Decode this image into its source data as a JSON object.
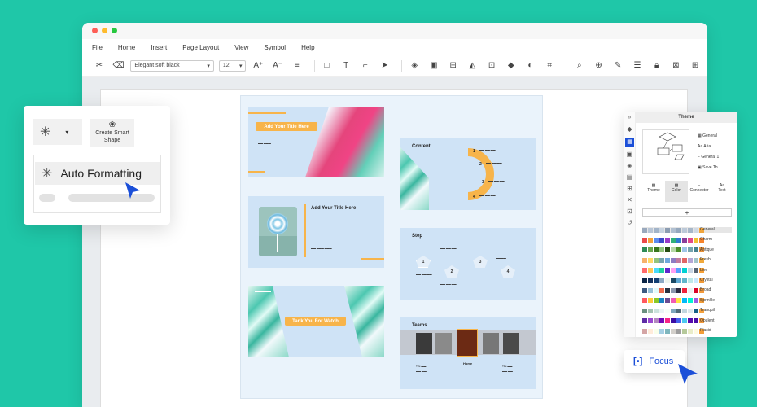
{
  "menu": [
    "File",
    "Home",
    "Insert",
    "Page Layout",
    "View",
    "Symbol",
    "Help"
  ],
  "toolbar": {
    "font": "Elegant soft black",
    "size": "12"
  },
  "left_panel": {
    "smart_shape_label": "Create Smart\nShape",
    "auto_formatting_label": "Auto Formatting"
  },
  "slides": {
    "s1_title": "Add Your Title Here",
    "s2_title": "Add Your Title Here",
    "s3_label": "Tank You For Watch",
    "content_title": "Content",
    "content_nums": [
      "1",
      "2",
      "3",
      "4"
    ],
    "step_title": "Step",
    "step_nums": [
      "1",
      "2",
      "3",
      "4"
    ],
    "teams_title": "Teams",
    "home_label": "Home",
    "title_label": "Title"
  },
  "theme_panel": {
    "header": "Theme",
    "menu": [
      "General",
      "Arial",
      "General 1",
      "Save Th..."
    ],
    "tabs": [
      "Theme",
      "Color",
      "Connector",
      "Text"
    ],
    "plus": "+",
    "palettes": [
      {
        "name": "General",
        "colors": [
          "#9aa9bd",
          "#b8c5d6",
          "#a2b4c9",
          "#c7d3e0",
          "#8c9db2",
          "#b0bfd0",
          "#95a8bd",
          "#bcc9d8",
          "#a7b7c9",
          "#d0d9e4",
          "#f0a53c"
        ]
      },
      {
        "name": "Charm",
        "colors": [
          "#e94a4a",
          "#f4a23b",
          "#5b8def",
          "#3c4ac8",
          "#9b3ac8",
          "#2fb07a",
          "#2f7bd1",
          "#8a3d9a",
          "#e24a8b",
          "#f1c232",
          "#f7842b"
        ]
      },
      {
        "name": "Antique",
        "colors": [
          "#2e8b57",
          "#6aa84f",
          "#38761d",
          "#93c47d",
          "#274e13",
          "#b6d7a8",
          "#4b8f29",
          "#9fc5e8",
          "#76a5af",
          "#45818e",
          "#e69138"
        ]
      },
      {
        "name": "Fresh",
        "colors": [
          "#f6b26b",
          "#ffd966",
          "#93c47d",
          "#76a5af",
          "#6fa8dc",
          "#8e7cc3",
          "#c27ba0",
          "#e06666",
          "#b4a7d6",
          "#a2c4c9",
          "#f1a93b"
        ]
      },
      {
        "name": "Live",
        "colors": [
          "#ff6b6b",
          "#feca57",
          "#48dbfb",
          "#1dd1a1",
          "#5f27cd",
          "#ff9ff3",
          "#54a0ff",
          "#00d2d3",
          "#c8d6e5",
          "#576574",
          "#f7a035"
        ]
      },
      {
        "name": "Crystal",
        "colors": [
          "#0b2545",
          "#13315c",
          "#134074",
          "#8da9c4",
          "#eef4ed",
          "#1b4965",
          "#5fa8d3",
          "#62b6cb",
          "#bee9e8",
          "#cae9ff",
          "#f29a36"
        ]
      },
      {
        "name": "Broad",
        "colors": [
          "#3d5a80",
          "#98c1d9",
          "#e0fbfc",
          "#ee6c4d",
          "#293241",
          "#8d99ae",
          "#2b2d42",
          "#ef233c",
          "#edf2f4",
          "#d90429",
          "#f49a3a"
        ]
      },
      {
        "name": "Sprinkle",
        "colors": [
          "#ff595e",
          "#ffca3a",
          "#8ac926",
          "#1982c4",
          "#6a4c93",
          "#f15bb5",
          "#fee440",
          "#00bbf9",
          "#00f5d4",
          "#9b5de5",
          "#f29c37"
        ]
      },
      {
        "name": "Tranquil",
        "colors": [
          "#6b9080",
          "#a4c3b2",
          "#cce3de",
          "#eaf4f4",
          "#f6fff8",
          "#7ea8be",
          "#4f6d7a",
          "#c0d6df",
          "#dbe9ee",
          "#166088",
          "#f5a13c"
        ]
      },
      {
        "name": "Opulent",
        "colors": [
          "#5e2ca5",
          "#9a48d0",
          "#b288c0",
          "#7209b7",
          "#f72585",
          "#3a0ca3",
          "#4361ee",
          "#4cc9f0",
          "#560bad",
          "#480ca8",
          "#f39a3a"
        ]
      },
      {
        "name": "Placid",
        "colors": [
          "#d4a5a5",
          "#ffecda",
          "#f9ffea",
          "#a6d0e4",
          "#7fb7be",
          "#d3d0cb",
          "#9e9e9e",
          "#b5c99a",
          "#e9edc9",
          "#fefae0",
          "#f29d38"
        ]
      }
    ]
  },
  "focus_label": "Focus",
  "colors": {
    "accent_green": "#1fc7a8",
    "orange": "#f7b44a",
    "blue": "#1b4fd8"
  }
}
